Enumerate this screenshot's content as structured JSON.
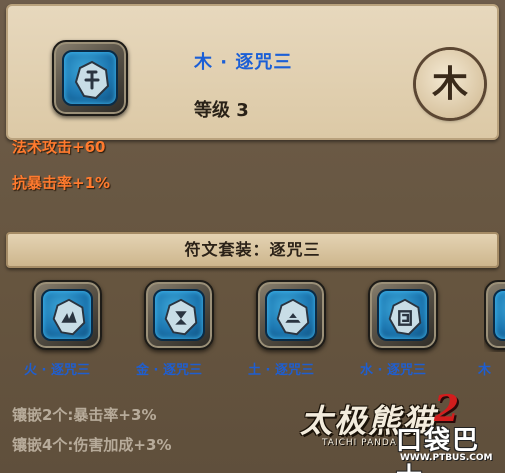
{
  "header": {
    "rune_name": "木 · 逐咒三",
    "level_text": "等级 3",
    "element_seal": "木",
    "icon": "rune-wood-icon"
  },
  "stats": [
    "法术攻击+60",
    "抗暴击率+1%"
  ],
  "set": {
    "banner": "符文套装：逐咒三",
    "items": [
      {
        "name": "火 · 逐咒三",
        "icon": "rune-fire-icon"
      },
      {
        "name": "金 · 逐咒三",
        "icon": "rune-metal-icon"
      },
      {
        "name": "土 · 逐咒三",
        "icon": "rune-earth-icon"
      },
      {
        "name": "水 · 逐咒三",
        "icon": "rune-water-icon"
      },
      {
        "name": "木",
        "icon": "rune-wood-icon"
      }
    ]
  },
  "bonuses": [
    "镶嵌2个:暴击率+3%",
    "镶嵌4个:伤害加成+3%"
  ],
  "watermark": {
    "game_title": "太极熊猫",
    "game_number": "2",
    "game_subtitle": "TAICHI PANDA",
    "site_name": "口袋巴士",
    "site_url": "WWW.PTBUS.COM"
  },
  "colors": {
    "rune_name": "#1b5fd6",
    "stat": "#ff7a2e",
    "bonus": "#b7ab9a",
    "panel": "#6b5a48"
  }
}
